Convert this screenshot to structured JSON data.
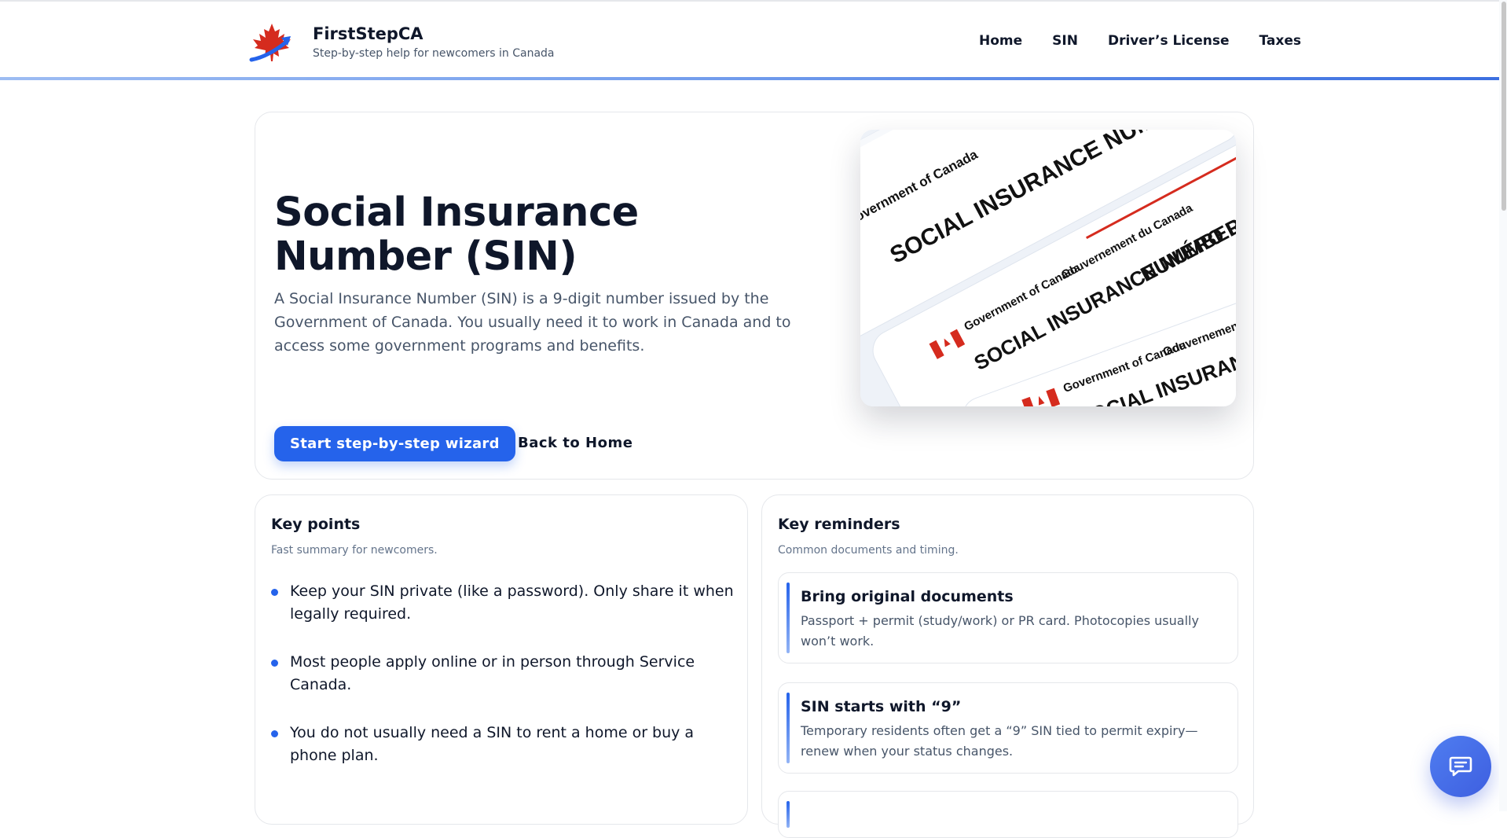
{
  "brand": {
    "name": "FirstStepCA",
    "tagline": "Step-by-step help for newcomers in Canada"
  },
  "nav": {
    "items": [
      "Home",
      "SIN",
      "Driver’s License",
      "Taxes"
    ]
  },
  "hero": {
    "title": "Social Insurance Number (SIN)",
    "description": "A Social Insurance Number (SIN) is a 9-digit number issued by the Government of Canada. You usually need it to work in Canada and to access some government programs and benefits.",
    "primary_button": "Start step-by-step wizard",
    "secondary_link": "Back to Home",
    "image_text": {
      "gov_en": "Government of Canada",
      "gov_fr": "Gouvernement du Canada",
      "card_en": "SOCIAL INSURANCE NUMBER",
      "card_fr": "NUMÉRO D’ASSURANCE SOCIALE"
    }
  },
  "key_points": {
    "title": "Key points",
    "subtitle": "Fast summary for newcomers.",
    "items": [
      "Keep your SIN private (like a password). Only share it when legally required.",
      "Most people apply online or in person through Service Canada.",
      "You do not usually need a SIN to rent a home or buy a phone plan."
    ]
  },
  "key_reminders": {
    "title": "Key reminders",
    "subtitle": "Common documents and timing.",
    "items": [
      {
        "title": "Bring original documents",
        "text": "Passport + permit (study/work) or PR card. Photocopies usually won’t work."
      },
      {
        "title": "SIN starts with “9”",
        "text": "Temporary residents often get a “9” SIN tied to permit expiry—renew when your status changes."
      }
    ]
  },
  "colors": {
    "accent": "#2563eb",
    "maple_red": "#d52b1e",
    "text": "#0f172a",
    "muted": "#475569"
  },
  "icons": {
    "logo": "maple-leaf-arrow-logo",
    "chat": "chat-bubble-icon"
  }
}
